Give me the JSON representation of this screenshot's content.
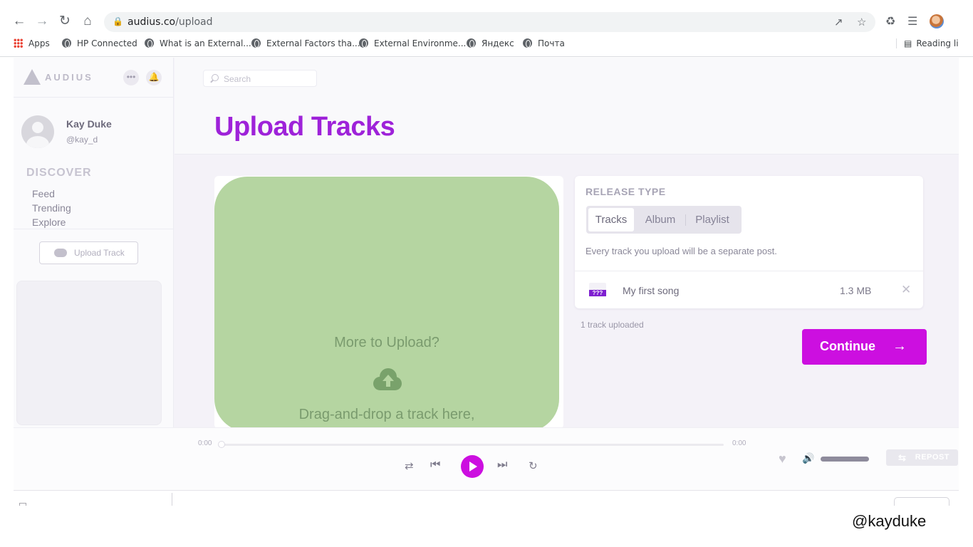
{
  "browser": {
    "url_host": "audius.co",
    "url_path": "/upload",
    "bookmarks": [
      {
        "label": "Apps"
      },
      {
        "label": "HP Connected"
      },
      {
        "label": "What is an External..."
      },
      {
        "label": "External Factors tha..."
      },
      {
        "label": "External Environme..."
      },
      {
        "label": "Яндекс"
      },
      {
        "label": "Почта"
      }
    ],
    "reading_list": "Reading li"
  },
  "sidebar": {
    "logo_text": "AUDIUS",
    "user": {
      "name": "Kay Duke",
      "handle": "@kay_d"
    },
    "section_title": "DISCOVER",
    "nav": [
      {
        "label": "Feed"
      },
      {
        "label": "Trending"
      },
      {
        "label": "Explore"
      }
    ],
    "upload_button": "Upload Track"
  },
  "header": {
    "search_placeholder": "Search",
    "title": "Upload Tracks"
  },
  "dropzone": {
    "heading": "More to Upload?",
    "instruction": "Drag-and-drop a track here,"
  },
  "release": {
    "label": "RELEASE TYPE",
    "tabs": [
      {
        "label": "Tracks",
        "selected": true
      },
      {
        "label": "Album",
        "selected": false
      },
      {
        "label": "Playlist",
        "selected": false
      }
    ],
    "description": "Every track you upload will be a separate post.",
    "tracks": [
      {
        "name": "My first song",
        "size": "1.3 MB",
        "icon_text": "???"
      }
    ],
    "count_text": "1 track uploaded",
    "continue_label": "Continue"
  },
  "player": {
    "time_elapsed": "0:00",
    "time_total": "0:00",
    "progress": 0,
    "repost_label": "REPOST"
  },
  "watermark": "@kayduke",
  "colors": {
    "accent": "#cc0fe0",
    "title_purple": "#9e22d9",
    "dropzone_green": "#b5d5a1"
  }
}
